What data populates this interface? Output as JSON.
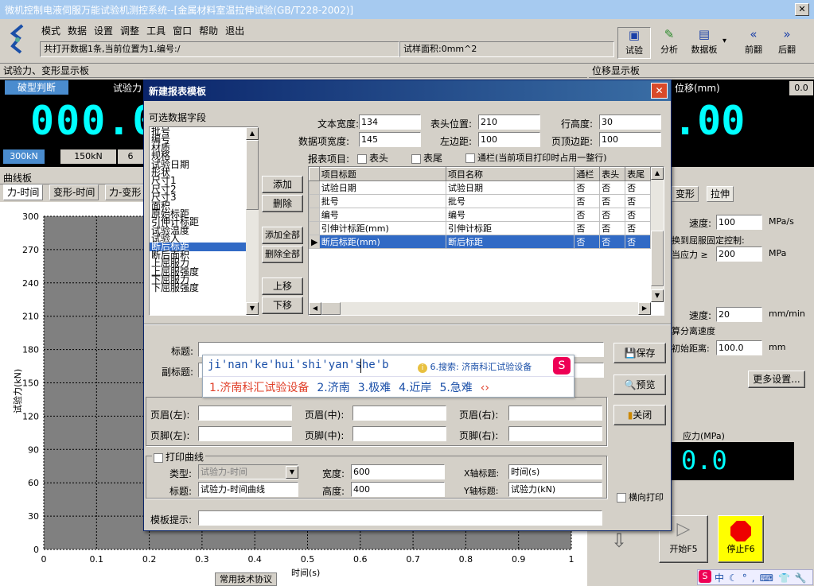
{
  "window": {
    "title": "微机控制电液伺服万能试验机测控系统--[金属材料室温拉伸试验(GB/T228-2002)]",
    "close_glyph": "✕"
  },
  "menu": {
    "items": [
      "模式",
      "数据",
      "设置",
      "调整",
      "工具",
      "窗口",
      "帮助",
      "退出"
    ]
  },
  "statusbar": {
    "left": "共打开数据1条,当前位置为1,编号:/",
    "right": "试样面积:0mm^2"
  },
  "toolbar": {
    "buttons": [
      {
        "label": "试验",
        "icon": "monitor-icon"
      },
      {
        "label": "分析",
        "icon": "pencil-icon"
      },
      {
        "label": "数据板",
        "icon": "panel-icon"
      },
      {
        "label": "前翻",
        "icon": "double-left-icon"
      },
      {
        "label": "后翻",
        "icon": "double-right-icon"
      }
    ],
    "arrow_glyph": "▾"
  },
  "force_panel": {
    "header": "试验力、变形显示板",
    "break_btn": "破型判断",
    "force_label": "试验力",
    "lcd": "000.0",
    "ranges": [
      "300kN",
      "150kN",
      "6"
    ],
    "selected_range": "300kN"
  },
  "disp_panel": {
    "header": "位移显示板",
    "label": "位移(mm)",
    "value": "0.0",
    "lcd": ".00"
  },
  "curve": {
    "header": "曲线板",
    "tabs": [
      "力-时间",
      "变形-时间",
      "力-变形"
    ],
    "ylabel": "试验力(kN)",
    "xlabel": "时间(s)",
    "footer": "常用技术协议"
  },
  "chart_data": {
    "type": "line",
    "title": "",
    "xlabel": "时间(s)",
    "ylabel": "试验力(kN)",
    "x_ticks": [
      "0",
      "0.1",
      "0.2",
      "0.3",
      "0.4",
      "0.5",
      "0.6",
      "0.7",
      "0.8",
      "0.9",
      "1"
    ],
    "y_ticks": [
      "0",
      "30",
      "60",
      "90",
      "120",
      "150",
      "180",
      "210",
      "240",
      "270",
      "300"
    ],
    "xlim": [
      0,
      1
    ],
    "ylim": [
      0,
      300
    ],
    "grid": true,
    "series": []
  },
  "right_panel": {
    "tabs": [
      "变形",
      "拉伸"
    ],
    "speed_label": "速度:",
    "speed_value": "100",
    "speed_unit": "MPa/s",
    "switch_label": "换到屈服固定控制:",
    "stress_label": "当应力 ≥",
    "stress_value": "200",
    "stress_unit": "MPa",
    "speed2_label": "速度:",
    "speed2_value": "20",
    "speed2_unit": "mm/min",
    "sep_label": "算分离速度",
    "init_label": "初始距离:",
    "init_value": "100.0",
    "init_unit": "mm",
    "more_btn": "更多设置...",
    "stress_display_label": "应力(MPa)",
    "stress_display": "0.0",
    "start_btn": "开始F5",
    "stop_btn": "停止F6"
  },
  "dialog": {
    "title": "新建报表模板",
    "close_glyph": "✕",
    "avail_label": "可选数据字段",
    "fields": [
      "批号",
      "编号",
      "材质",
      "规格",
      "试验日期",
      "形状",
      "尺寸1",
      "尺寸2",
      "尺寸3",
      "面积",
      "原始标距",
      "引伸计标距",
      "试验温度",
      "试验人",
      "断后标距",
      "断后面积",
      "上屈服力",
      "上屈服强度",
      "下屈服力",
      "下屈服强度"
    ],
    "selected_field": "断后标距",
    "buttons": {
      "add": "添加",
      "delete": "删除",
      "add_all": "添加全部",
      "delete_all": "删除全部",
      "up": "上移",
      "down": "下移"
    },
    "params": {
      "text_width_label": "文本宽度:",
      "text_width": "134",
      "header_pos_label": "表头位置:",
      "header_pos": "210",
      "row_height_label": "行高度:",
      "row_height": "30",
      "data_width_label": "数据项宽度:",
      "data_width": "145",
      "left_margin_label": "左边距:",
      "left_margin": "100",
      "top_margin_label": "页顶边距:",
      "top_margin": "100"
    },
    "report_items_label": "报表项目:",
    "chk_header": "表头",
    "chk_footer": "表尾",
    "chk_span": "通栏(当前项目打印时占用一整行)",
    "grid": {
      "headers": [
        "项目标题",
        "项目名称",
        "通栏",
        "表头",
        "表尾"
      ],
      "rows": [
        [
          "试验日期",
          "试验日期",
          "否",
          "否",
          "否"
        ],
        [
          "批号",
          "批号",
          "否",
          "否",
          "否"
        ],
        [
          "编号",
          "编号",
          "否",
          "否",
          "否"
        ],
        [
          "引伸计标距(mm)",
          "引伸计标距",
          "否",
          "否",
          "否"
        ],
        [
          "断后标距(mm)",
          "断后标距",
          "否",
          "否",
          "否"
        ]
      ],
      "selected_row": 4,
      "row_pointer": "▶"
    },
    "title_label": "标题:",
    "subtitle_label": "副标题:",
    "save_btn": "保存",
    "preview_btn": "预览",
    "close_btn": "关闭",
    "hf": {
      "header_left": "页眉(左):",
      "header_mid": "页眉(中):",
      "header_right": "页眉(右):",
      "footer_left": "页脚(左):",
      "footer_mid": "页脚(中):",
      "footer_right": "页脚(右):"
    },
    "print_curve": "打印曲线",
    "type_label": "类型:",
    "type_value": "试验力-时间",
    "width_label": "宽度:",
    "width_value": "600",
    "xaxis_label": "X轴标题:",
    "xaxis_value": "时间(s)",
    "title2_label": "标题:",
    "title2_value": "试验力-时间曲线",
    "height_label": "高度:",
    "height_value": "400",
    "yaxis_label": "Y轴标题:",
    "yaxis_value": "试验力(kN)",
    "landscape": "横向打印",
    "tip_label": "模板提示:"
  },
  "ime": {
    "composition": "ji'nan'ke'hui'shi'yan'she'b",
    "search": "6.搜索: 济南科汇试验设备",
    "candidates": [
      "1.济南科汇试验设备",
      "2.济南",
      "3.极难",
      "4.近岸",
      "5.急难"
    ]
  },
  "tray": {
    "items": [
      "中",
      "☾",
      "°,",
      "⌨",
      "👕",
      "🔧"
    ]
  },
  "colors": {
    "accent": "#0a246a",
    "lcd_text": "#00ffff",
    "selection": "#316ac5"
  }
}
